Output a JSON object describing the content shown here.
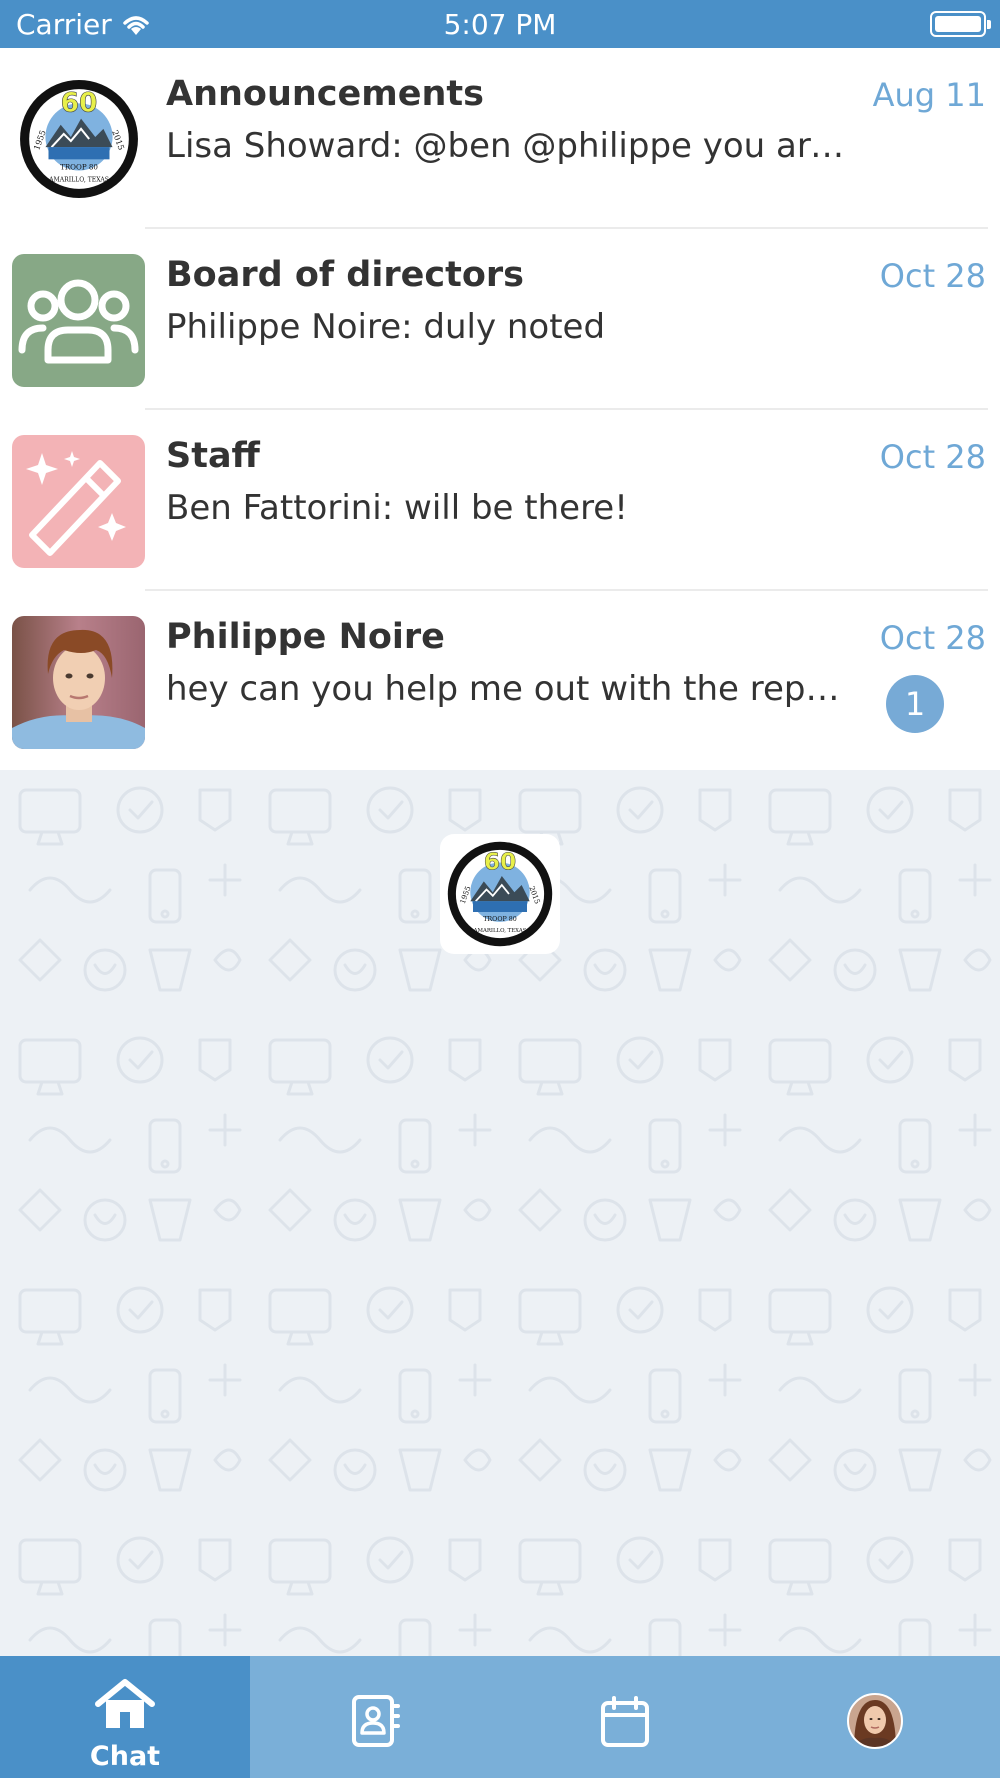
{
  "status_bar": {
    "carrier": "Carrier",
    "time": "5:07 PM",
    "icons": [
      "wifi-icon",
      "battery-icon"
    ]
  },
  "chats": [
    {
      "title": "Announcements",
      "preview": "Lisa Showard: @ben @philippe you are required to attend the meeting",
      "date": "Aug 11",
      "avatar": "troop-80-logo",
      "unread": ""
    },
    {
      "title": "Board of directors",
      "preview": "Philippe Noire: duly noted",
      "date": "Oct 28",
      "avatar": "group-icon",
      "avatar_color": "#87a886",
      "unread": ""
    },
    {
      "title": "Staff",
      "preview": "Ben Fattorini: will be there!",
      "date": "Oct 28",
      "avatar": "magic-wand-icon",
      "avatar_color": "#f3b3b6",
      "unread": ""
    },
    {
      "title": "Philippe Noire",
      "preview": "hey can you help me out with the report for the board meeting?",
      "date": "Oct 28",
      "avatar": "user-photo",
      "unread": "1"
    }
  ],
  "logo_text": {
    "number": "60",
    "years": [
      "1955",
      "2015"
    ],
    "troop": "TROOP 80",
    "location": "AMARILLO, TEXAS"
  },
  "tab_bar": {
    "tabs": [
      {
        "label": "Chat",
        "icon": "home-icon",
        "active": true
      },
      {
        "label": "",
        "icon": "contacts-icon",
        "active": false
      },
      {
        "label": "",
        "icon": "calendar-icon",
        "active": false
      },
      {
        "label": "",
        "icon": "profile-avatar",
        "active": false
      }
    ]
  },
  "colors": {
    "primary": "#4a90c8",
    "tab_bar": "#7aafd8",
    "date": "#6fa8d6",
    "badge": "#77aad6",
    "board_avatar": "#87a886",
    "staff_avatar": "#f3b3b6",
    "background_pattern": "#edf1f5"
  }
}
